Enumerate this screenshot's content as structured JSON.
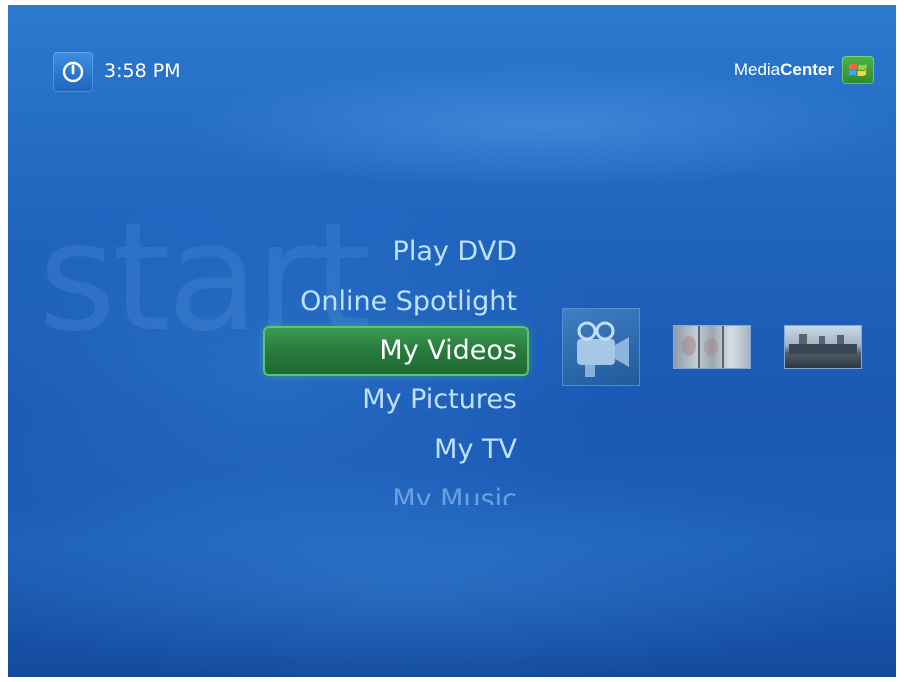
{
  "header": {
    "time": "3:58 PM",
    "brand_light": "Media",
    "brand_bold": "Center"
  },
  "watermark": "start",
  "menu": {
    "items": [
      {
        "label": "Play DVD"
      },
      {
        "label": "Online Spotlight"
      },
      {
        "label": "My Videos",
        "selected": true
      },
      {
        "label": "My Pictures"
      },
      {
        "label": "My TV"
      },
      {
        "label": "My Music"
      }
    ]
  },
  "thumbnails": [
    {
      "name": "video-camera-icon"
    },
    {
      "name": "video-clip-thumbnail"
    },
    {
      "name": "building-video-thumbnail"
    }
  ],
  "colors": {
    "selection": "#2a7d3f",
    "background": "#1f63bd",
    "accent": "#bfe0ff"
  }
}
